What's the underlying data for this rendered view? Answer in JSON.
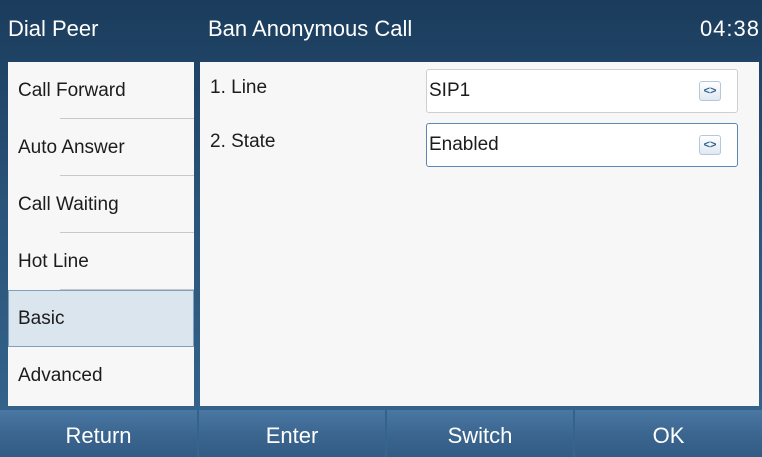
{
  "header": {
    "menu_title": "Dial Peer",
    "page_title": "Ban Anonymous Call",
    "time": "04:38"
  },
  "sidebar": {
    "items": [
      {
        "label": "Call Forward"
      },
      {
        "label": "Auto Answer"
      },
      {
        "label": "Call Waiting"
      },
      {
        "label": "Hot Line"
      },
      {
        "label": "Basic",
        "selected": true
      },
      {
        "label": "Advanced"
      }
    ]
  },
  "main": {
    "rows": [
      {
        "label": "1. Line",
        "value": "SIP1",
        "arrow": "<>"
      },
      {
        "label": "2. State",
        "value": "Enabled",
        "arrow": "<>"
      }
    ]
  },
  "softkeys": {
    "return_label": "Return",
    "enter_label": "Enter",
    "switch_label": "Switch",
    "ok_label": "OK"
  },
  "colors": {
    "background_dark": "#1b3c5c",
    "background_light": "#36658e",
    "panel": "#f7f7f7",
    "selected_item": "#dbe5ee",
    "softkey": "#3b6690",
    "focus_border": "#5b86b5"
  },
  "icons": {
    "selector_arrows": "left-right-arrows-icon"
  }
}
